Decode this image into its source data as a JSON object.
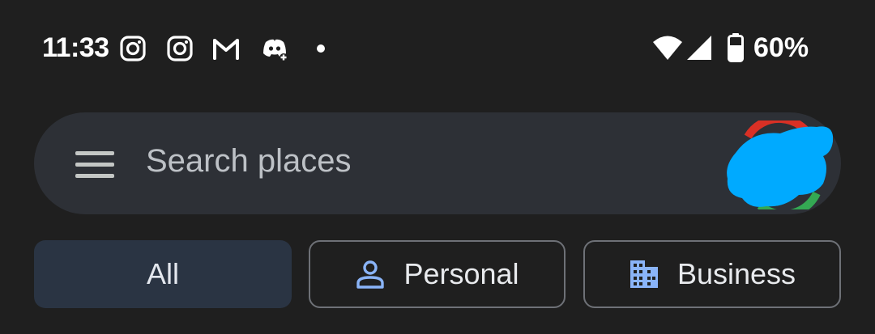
{
  "status_bar": {
    "time": "11:33",
    "battery": "60%",
    "notification_icons": [
      "instagram-icon",
      "instagram-icon",
      "gmail-icon",
      "discord-icon"
    ],
    "system_icons": [
      "wifi-icon",
      "cellular-signal-icon",
      "battery-icon"
    ]
  },
  "search": {
    "placeholder": "Search places",
    "menu_icon": "hamburger-menu-icon",
    "avatar": "account-avatar"
  },
  "chips": [
    {
      "label": "All",
      "selected": true
    },
    {
      "label": "Personal",
      "icon": "person-icon",
      "selected": false
    },
    {
      "label": "Business",
      "icon": "building-icon",
      "selected": false
    }
  ],
  "colors": {
    "background": "#1f1f1f",
    "search_bar": "#2d3036",
    "selected_chip": "#2a3443",
    "chip_border": "#6e7177",
    "accent_icon": "#8ab4f8",
    "avatar_redaction": "#00aaff"
  }
}
